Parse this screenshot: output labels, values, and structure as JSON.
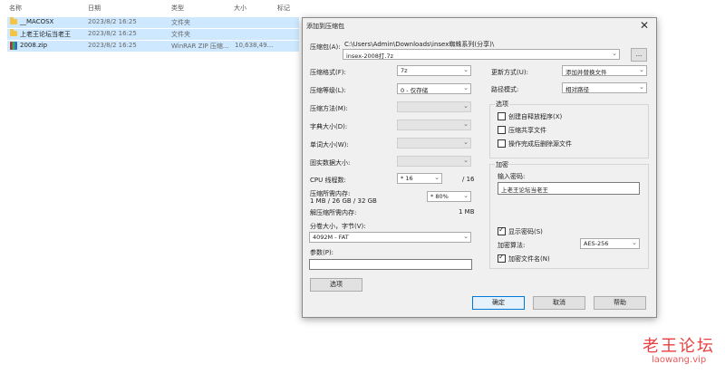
{
  "filelist": {
    "headers": {
      "name": "名称",
      "date": "日期",
      "type": "类型",
      "size": "大小",
      "tag": "标记"
    },
    "rows": [
      {
        "name": "__MACOSX",
        "date": "2023/8/2 16:25",
        "type": "文件夹",
        "size": "",
        "icon": "folder-icon"
      },
      {
        "name": "上老王论坛当老王",
        "date": "2023/8/2 16:25",
        "type": "文件夹",
        "size": "",
        "icon": "folder-icon"
      },
      {
        "name": "2008.zip",
        "date": "2023/8/2 16:25",
        "type": "WinRAR ZIP 压缩...",
        "size": "10,638,49...",
        "icon": "zip-icon"
      }
    ]
  },
  "dialog": {
    "title": "添加到压缩包",
    "archive_label": "压缩包(A):",
    "archive_path": "C:\\Users\\Admin\\Downloads\\insex蜘蛛系列(分享)\\",
    "archive_name": "insex-2008打.7z",
    "browse": "...",
    "format_label": "压缩格式(F):",
    "format_value": "7z",
    "level_label": "压缩等级(L):",
    "level_value": "0 - 仅存储",
    "method_label": "压缩方法(M):",
    "dict_label": "字典大小(D):",
    "word_label": "单词大小(W):",
    "solid_label": "固实数据大小:",
    "threads_label": "CPU 线程数:",
    "threads_value": "* 16",
    "threads_max": "/ 16",
    "mem_label": "压缩所需内存:",
    "mem_detail": "1 MB / 26 GB / 32 GB",
    "mem_value": "* 80%",
    "decomp_label": "解压缩所需内存:",
    "decomp_value": "1 MB",
    "split_label": "分卷大小，字节(V):",
    "split_value": "4092M - FAT",
    "params_label": "参数(P):",
    "options_btn": "选项",
    "update_label": "更新方式(U):",
    "update_value": "添加并替换文件",
    "pathmode_label": "路径模式:",
    "pathmode_value": "相对路径",
    "options_group": "选项",
    "opt_sfx": "创建自释放程序(X)",
    "opt_shared": "压缩共享文件",
    "opt_delete": "操作完成后删除源文件",
    "encrypt_group": "加密",
    "pwd_label": "输入密码:",
    "pwd_value": "上老王论坛当老王",
    "show_pwd": "显示密码(S)",
    "enc_method_label": "加密算法:",
    "enc_method_value": "AES-256",
    "enc_names": "加密文件名(N)",
    "ok": "确定",
    "cancel": "取消",
    "help": "帮助"
  },
  "watermark": {
    "cn": "老王论坛",
    "url": "laowang.vip"
  }
}
